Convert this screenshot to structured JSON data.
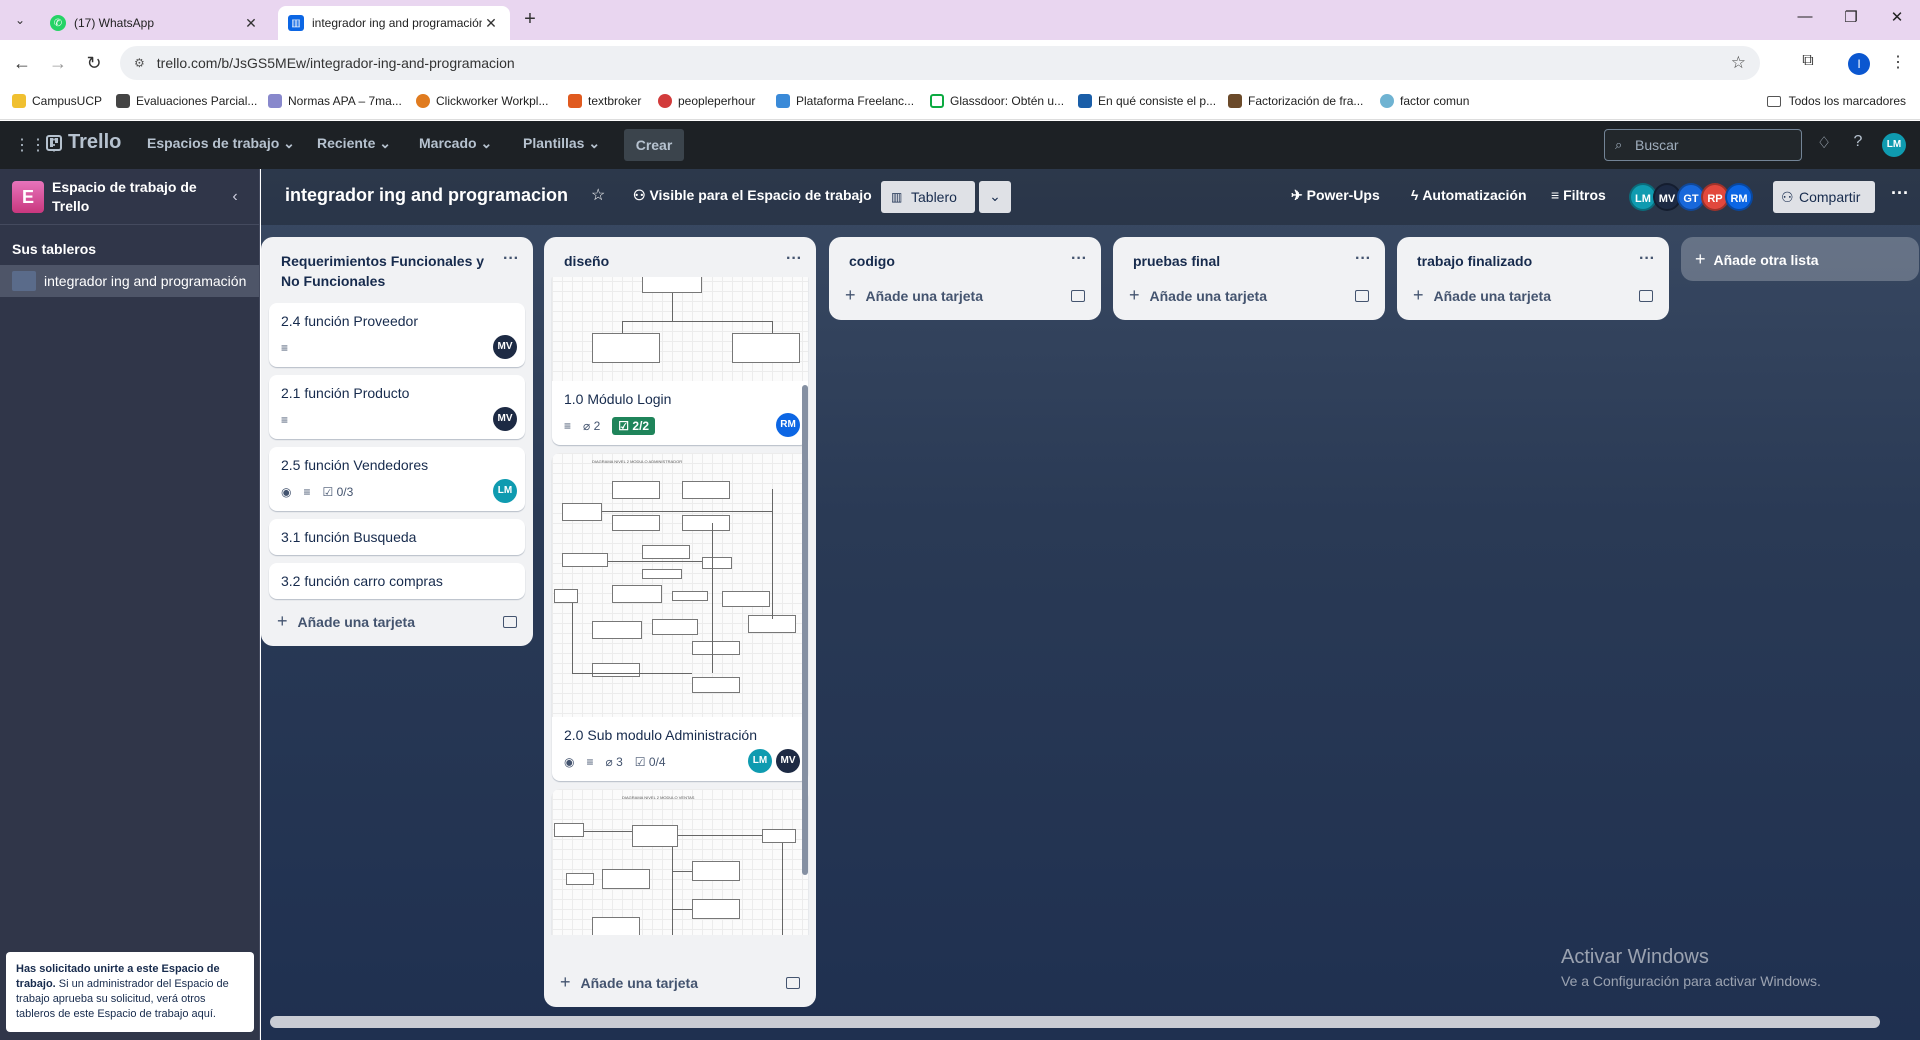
{
  "browser": {
    "tabs": [
      {
        "title": "(17) WhatsApp",
        "icon": "whatsapp-icon"
      },
      {
        "title": "integrador ing and programación",
        "icon": "trello-icon"
      }
    ],
    "url": "trello.com/b/JsGS5MEw/integrador-ing-and-programacion",
    "profile_initial": "I",
    "bookmarks": [
      "CampusUCP",
      "Evaluaciones Parcial...",
      "Normas APA – 7ma...",
      "Clickworker Workpl...",
      "textbroker",
      "peopleperhour",
      "Plataforma Freelanc...",
      "Glassdoor: Obtén u...",
      "En qué consiste el p...",
      "Factorización de fra...",
      "factor comun"
    ],
    "all_bookmarks": "Todos los marcadores"
  },
  "header": {
    "logo": "Trello",
    "menus": [
      "Espacios de trabajo",
      "Reciente",
      "Marcado",
      "Plantillas"
    ],
    "create": "Crear",
    "search_placeholder": "Buscar",
    "user_initials": "LM"
  },
  "sidebar": {
    "workspace_initial": "E",
    "workspace_name": "Espacio de trabajo de Trello",
    "boards_section": "Sus tableros",
    "board": "integrador ing and programación",
    "join_note_bold": "Has solicitado unirte a este Espacio de trabajo.",
    "join_note_text": " Si un administrador del Espacio de trabajo aprueba su solicitud, verá otros tableros de este Espacio de trabajo aquí."
  },
  "board": {
    "title": "integrador ing and programacion",
    "visibility": "Visible para el Espacio de trabajo",
    "view": "Tablero",
    "powerups": "Power-Ups",
    "automation": "Automatización",
    "filters": "Filtros",
    "share": "Compartir",
    "members": [
      {
        "initials": "LM",
        "color": "#0f9bb0"
      },
      {
        "initials": "MV",
        "color": "#1d2a44"
      },
      {
        "initials": "GT",
        "color": "#1868db"
      },
      {
        "initials": "RP",
        "color": "#e2483d"
      },
      {
        "initials": "RM",
        "color": "#0c66e4"
      }
    ],
    "add_card": "Añade una tarjeta",
    "add_list": "Añade otra lista"
  },
  "lists": {
    "requirements": {
      "title": "Requerimientos Funcionales y No Funcionales",
      "cards": [
        {
          "title": "2.4 función Proveedor",
          "avatar": "MV"
        },
        {
          "title": "2.1 función Producto",
          "avatar": "MV"
        },
        {
          "title": "2.5 función Vendedores",
          "checklist": "0/3",
          "avatar": "LM"
        },
        {
          "title": "3.1 función Busqueda"
        },
        {
          "title": "3.2 función carro compras"
        }
      ]
    },
    "design": {
      "title": "diseño",
      "cards": [
        {
          "title": "1.0 Módulo Login",
          "attachments": "2",
          "checklist": "2/2",
          "avatar": "RM"
        },
        {
          "title": "2.0 Sub modulo Administración",
          "attachments": "3",
          "checklist": "0/4",
          "avatars": [
            "LM",
            "MV"
          ]
        },
        {
          "cover_caption": "DIAGRAMA NIVEL 2 MODULO VENTAS"
        }
      ],
      "cover_caption_2": "DIAGRAMA NIVEL 2 MODULO ADMINISTRADOR"
    },
    "code": {
      "title": "codigo"
    },
    "tests": {
      "title": "pruebas final"
    },
    "done": {
      "title": "trabajo finalizado"
    }
  },
  "watermark": {
    "line1": "Activar Windows",
    "line2": "Ve a Configuración para activar Windows."
  }
}
